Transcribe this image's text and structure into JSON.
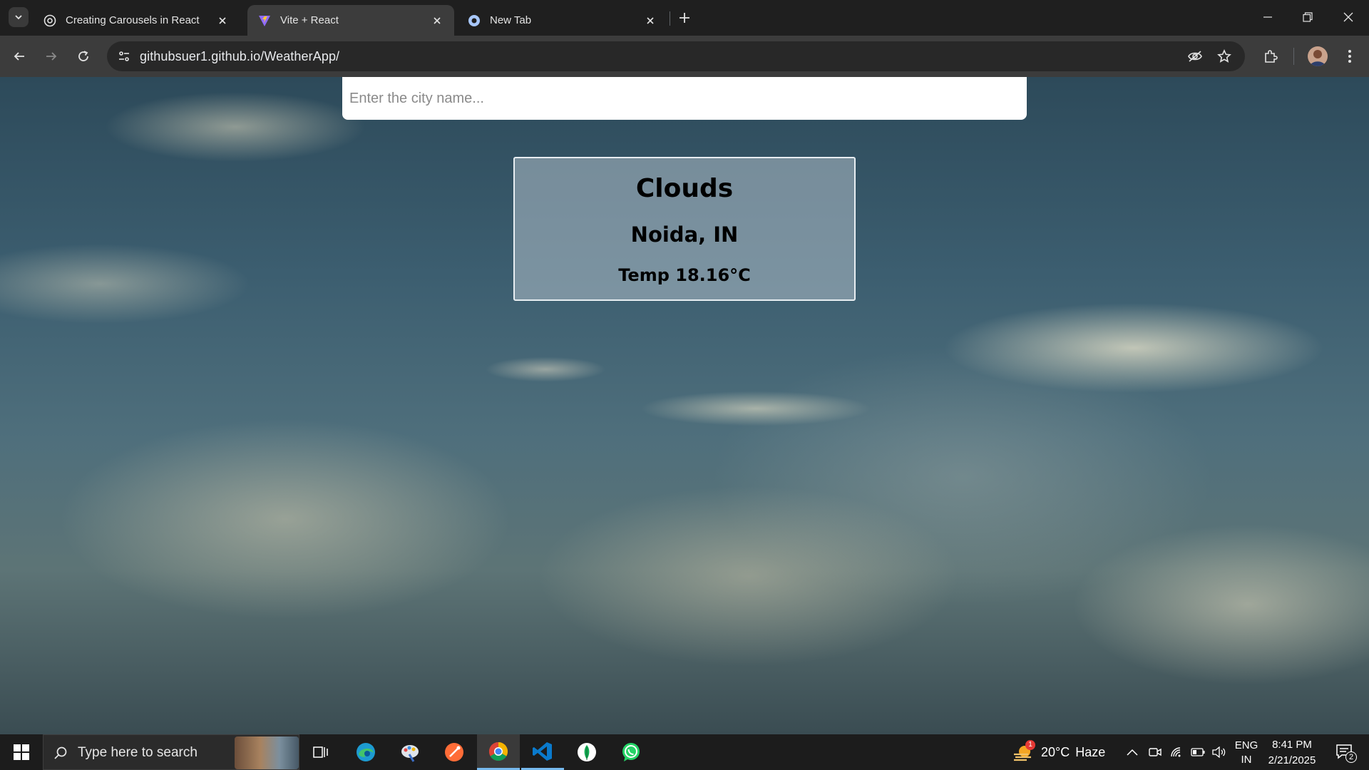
{
  "browser": {
    "tabs": [
      {
        "title": "Creating Carousels in React",
        "active": false
      },
      {
        "title": "Vite + React",
        "active": true
      },
      {
        "title": "New Tab",
        "active": false
      }
    ],
    "url": "githubsuer1.github.io/WeatherApp/"
  },
  "weather_app": {
    "search": {
      "placeholder": "Enter the city name...",
      "value": ""
    },
    "condition": "Clouds",
    "location": "Noida, IN",
    "temperature": "Temp 18.16°C"
  },
  "taskbar": {
    "search_placeholder": "Type here to search",
    "weather": {
      "temp": "20°C",
      "condition": "Haze",
      "badge": "1"
    },
    "language": {
      "line1": "ENG",
      "line2": "IN"
    },
    "clock": {
      "time": "8:41 PM",
      "date": "2/21/2025"
    },
    "notifications_count": "2"
  },
  "colors": {
    "chrome_bg": "#1f1f1f",
    "toolbar_bg": "#3c3c3c",
    "taskbar_bg": "#1c1c1c",
    "active_indicator": "#76b9ed"
  }
}
